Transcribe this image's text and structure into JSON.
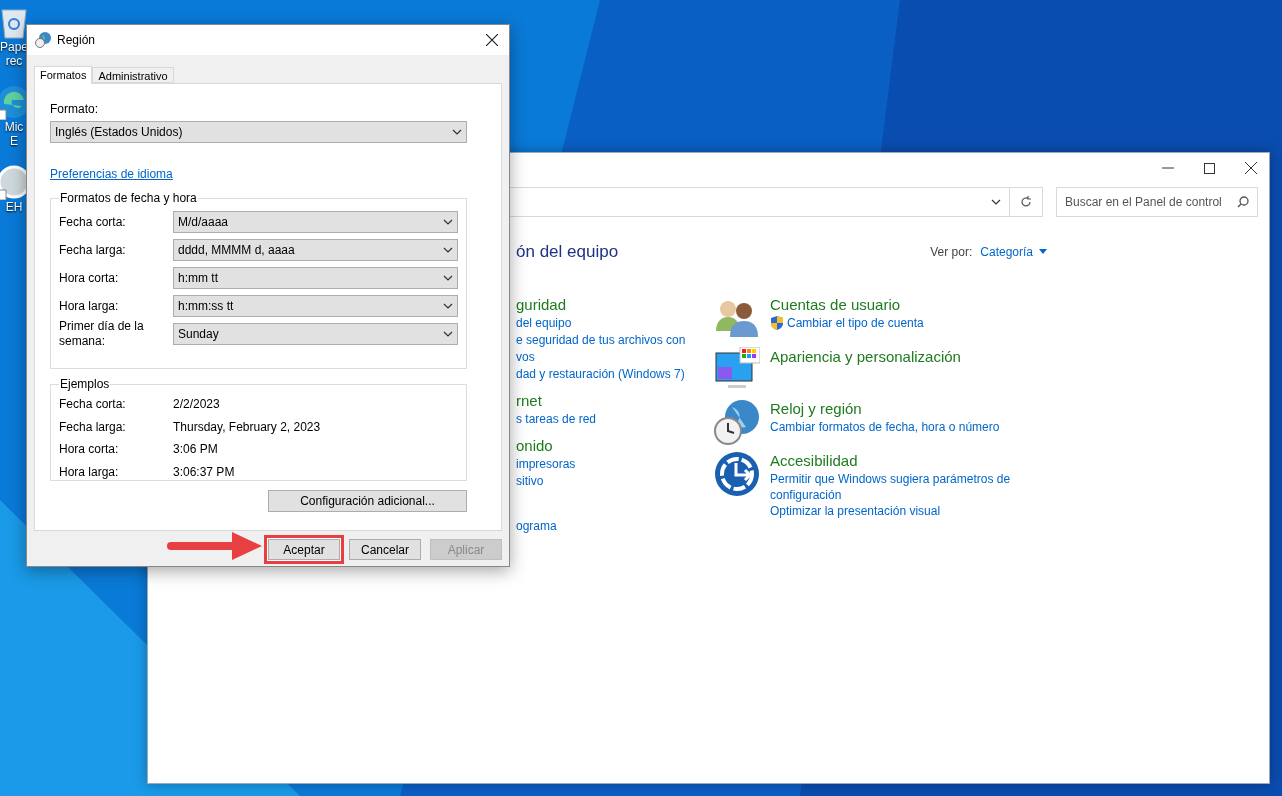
{
  "desktop_icons": [
    {
      "kind": "recycle",
      "lines": [
        "Pape",
        "rec"
      ]
    },
    {
      "kind": "edge",
      "lines": [
        "Mic",
        "E"
      ]
    },
    {
      "kind": "shortcut",
      "lines": [
        "EH"
      ]
    }
  ],
  "control_panel": {
    "search": {
      "placeholder": "Buscar en el Panel de control"
    },
    "heading": "ón del equipo",
    "view_by": {
      "label": "Ver por:",
      "value": "Categoría"
    },
    "left_categories": [
      {
        "title": "guridad",
        "links": [
          "del equipo",
          "e seguridad de tus archivos con",
          "vos",
          "dad y restauración (Windows 7)"
        ]
      },
      {
        "title": "rnet",
        "links": [
          "s tareas de red"
        ]
      },
      {
        "title": "onido",
        "links": [
          "impresoras",
          "sitivo"
        ]
      },
      {
        "links": [
          "ograma"
        ]
      }
    ],
    "right_categories": [
      {
        "kind": "users",
        "title": "Cuentas de usuario",
        "links": [
          {
            "text": "Cambiar el tipo de cuenta",
            "shield": true
          }
        ]
      },
      {
        "kind": "appearance",
        "title": "Apariencia y personalización"
      },
      {
        "kind": "clock",
        "title": "Reloj y región",
        "links": [
          {
            "text": "Cambiar formatos de fecha, hora o número",
            "shield": false
          }
        ]
      },
      {
        "kind": "access",
        "title": "Accesibilidad",
        "links": [
          {
            "text": "Permitir que Windows sugiera parámetros de configuración",
            "shield": false
          },
          {
            "text": "Optimizar la presentación visual",
            "shield": false
          }
        ]
      }
    ]
  },
  "dialog": {
    "title": "Región",
    "tabs": [
      {
        "label": "Formatos",
        "selected": true
      },
      {
        "label": "Administrativo",
        "selected": false
      }
    ],
    "format": {
      "label": "Formato:",
      "value": "Inglés (Estados Unidos)"
    },
    "language_link": "Preferencias de idioma",
    "formats_group": {
      "title": "Formatos de fecha y hora",
      "rows": [
        {
          "label": "Fecha corta:",
          "value": "M/d/aaaa"
        },
        {
          "label": "Fecha larga:",
          "value": "dddd, MMMM d, aaaa"
        },
        {
          "label": "Hora corta:",
          "value": "h:mm tt"
        },
        {
          "label": "Hora larga:",
          "value": "h:mm:ss tt"
        },
        {
          "label": "Primer día de la semana:",
          "value": "Sunday"
        }
      ]
    },
    "examples_group": {
      "title": "Ejemplos",
      "rows": [
        {
          "label": "Fecha corta:",
          "value": "2/2/2023"
        },
        {
          "label": "Fecha larga:",
          "value": "Thursday, February 2, 2023"
        },
        {
          "label": "Hora corta:",
          "value": "3:06 PM"
        },
        {
          "label": "Hora larga:",
          "value": "3:06:37 PM"
        }
      ]
    },
    "additional_button": "Configuración adicional...",
    "buttons": [
      {
        "label": "Aceptar",
        "disabled": false,
        "highlighted": true
      },
      {
        "label": "Cancelar",
        "disabled": false,
        "highlighted": false
      },
      {
        "label": "Aplicar",
        "disabled": true,
        "highlighted": false
      }
    ]
  }
}
